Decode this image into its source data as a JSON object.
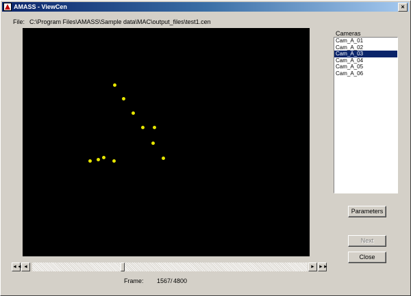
{
  "window": {
    "title": "AMASS - ViewCen",
    "close_glyph": "×"
  },
  "file": {
    "label": "File:",
    "path": "C:\\Program Files\\AMASS\\Sample data\\MAC\\output_files\\test1.cen"
  },
  "cameras": {
    "label": "Cameras",
    "items": [
      "Cam_A_01",
      "Cam_A_02",
      "Cam_A_03",
      "Cam_A_04",
      "Cam_A_05",
      "Cam_A_06"
    ],
    "selected_index": 2
  },
  "buttons": {
    "parameters": "Parameters",
    "next": "Next",
    "close": "Close"
  },
  "scrollbar": {
    "first_glyph": "◄◄",
    "prev_glyph": "◄",
    "next_glyph": "►",
    "last_glyph": "►►",
    "position_fraction": 0.326
  },
  "frame": {
    "label": "Frame:",
    "current": "1567",
    "separator": "/",
    "total": "4800"
  },
  "colors": {
    "marker": "#e6e600",
    "viewport_bg": "#000000",
    "selection": "#0a246a"
  }
}
